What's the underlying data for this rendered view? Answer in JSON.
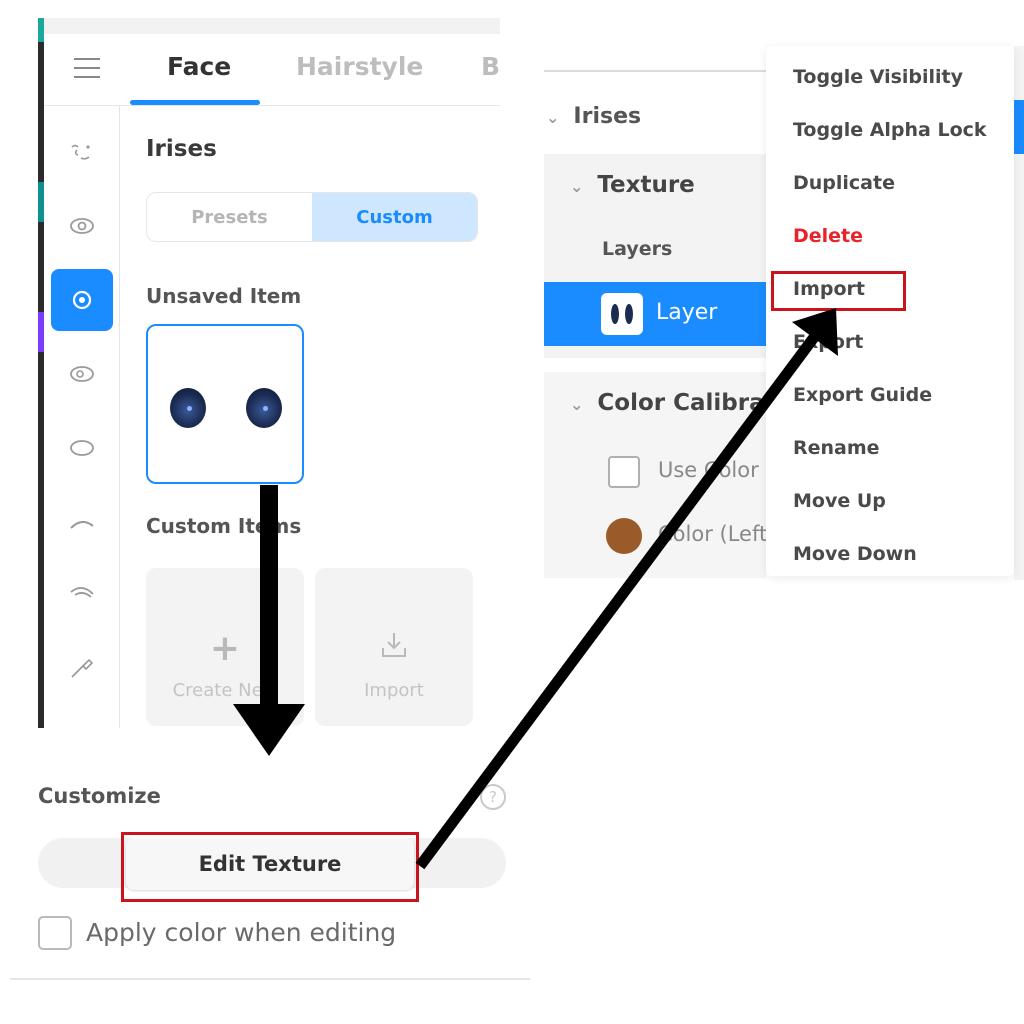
{
  "left": {
    "tabs": [
      {
        "label": "Face",
        "active": true
      },
      {
        "label": "Hairstyle",
        "active": false
      },
      {
        "label": "Bo",
        "active": false
      }
    ],
    "sidebar_icons": [
      "face-icon",
      "eye-icon",
      "iris-icon",
      "eye-outline-icon",
      "eye-shape-icon",
      "eyebrow-icon",
      "eyelash-icon",
      "makeup-brush-icon"
    ],
    "section_title": "Irises",
    "segmented": {
      "presets": "Presets",
      "custom": "Custom",
      "selected": "Custom"
    },
    "unsaved_label": "Unsaved Item",
    "custom_items_label": "Custom Items",
    "create_new_label": "Create New",
    "import_label": "Import",
    "customize_label": "Customize",
    "help_glyph": "?",
    "edit_texture_label": "Edit Texture",
    "apply_color_label": "Apply color when editing"
  },
  "right": {
    "irises_label": "Irises",
    "texture_label": "Texture",
    "layers_label": "Layers",
    "layer_name": "Layer",
    "color_calibration_label": "Color Calibration",
    "use_color_label": "Use Color Calibration",
    "color_left_label": "Color (Left)",
    "color_left_value": "#9a5a2a",
    "context_menu": [
      {
        "label": "Toggle Visibility",
        "danger": false
      },
      {
        "label": "Toggle Alpha Lock",
        "danger": false
      },
      {
        "label": "Duplicate",
        "danger": false
      },
      {
        "label": "Delete",
        "danger": true
      },
      {
        "label": "Import",
        "danger": false,
        "highlighted": true
      },
      {
        "label": "Export",
        "danger": false
      },
      {
        "label": "Export Guide",
        "danger": false
      },
      {
        "label": "Rename",
        "danger": false
      },
      {
        "label": "Move Up",
        "danger": false
      },
      {
        "label": "Move Down",
        "danger": false
      }
    ]
  },
  "colors": {
    "accent": "#1a8cff",
    "annotation_red": "#c8141c",
    "danger": "#e8232a"
  }
}
